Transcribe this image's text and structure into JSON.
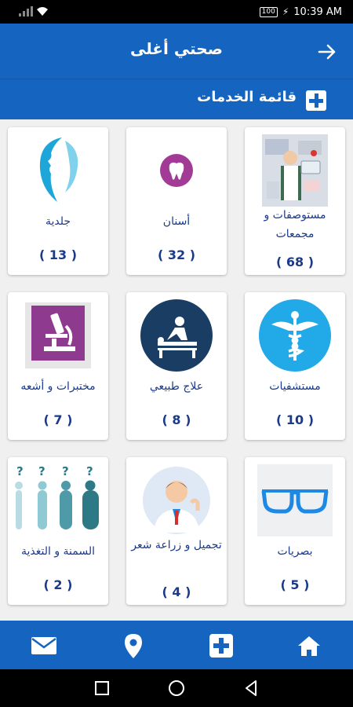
{
  "status": {
    "battery": "100",
    "time": "10:39 AM"
  },
  "header": {
    "title": "صحتي أغلى",
    "back_icon": "arrow-right-icon"
  },
  "section": {
    "title": "قائمة الخدمات",
    "icon": "plus-box-icon"
  },
  "services": [
    {
      "name": "مستوصفات و مجمعات",
      "count": "( 68 )",
      "icon": "pharmacy-shelf-icon"
    },
    {
      "name": "أسنان",
      "count": "( 32 )",
      "icon": "tooth-icon"
    },
    {
      "name": "جلدية",
      "count": "( 13 )",
      "icon": "face-profile-icon"
    },
    {
      "name": "مستشفيات",
      "count": "( 10 )",
      "icon": "caduceus-icon"
    },
    {
      "name": "علاج طبيعي",
      "count": "( 8 )",
      "icon": "physiotherapy-icon"
    },
    {
      "name": "مختبرات و أشعه",
      "count": "( 7 )",
      "icon": "microscope-icon"
    },
    {
      "name": "بصريات",
      "count": "( 5 )",
      "icon": "glasses-icon"
    },
    {
      "name": "تجميل و زراعة شعر",
      "count": "( 4 )",
      "icon": "doctor-icon"
    },
    {
      "name": "السمنة و التغذية",
      "count": "( 2 )",
      "icon": "body-weight-icon"
    }
  ],
  "bottom_nav": [
    "home-icon",
    "plus-icon",
    "location-pin-icon",
    "mail-icon"
  ],
  "colors": {
    "primary": "#1565c0",
    "text": "#1a3a8a"
  }
}
